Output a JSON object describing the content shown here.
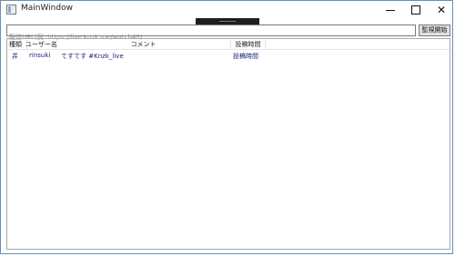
{
  "window": {
    "title": "MainWindow"
  },
  "toolbar": {
    "url_placeholder": "配信URL(例: https://live.knzk.me/watch40)",
    "start_label": "監視開始"
  },
  "table": {
    "columns": [
      "種類",
      "ユーザー名",
      "コメント",
      "投稿時間"
    ],
    "rows": [
      {
        "type": "井",
        "user": "rinsuki",
        "comment": "てすてす #Knzk_live",
        "time": "投稿時間"
      }
    ]
  }
}
